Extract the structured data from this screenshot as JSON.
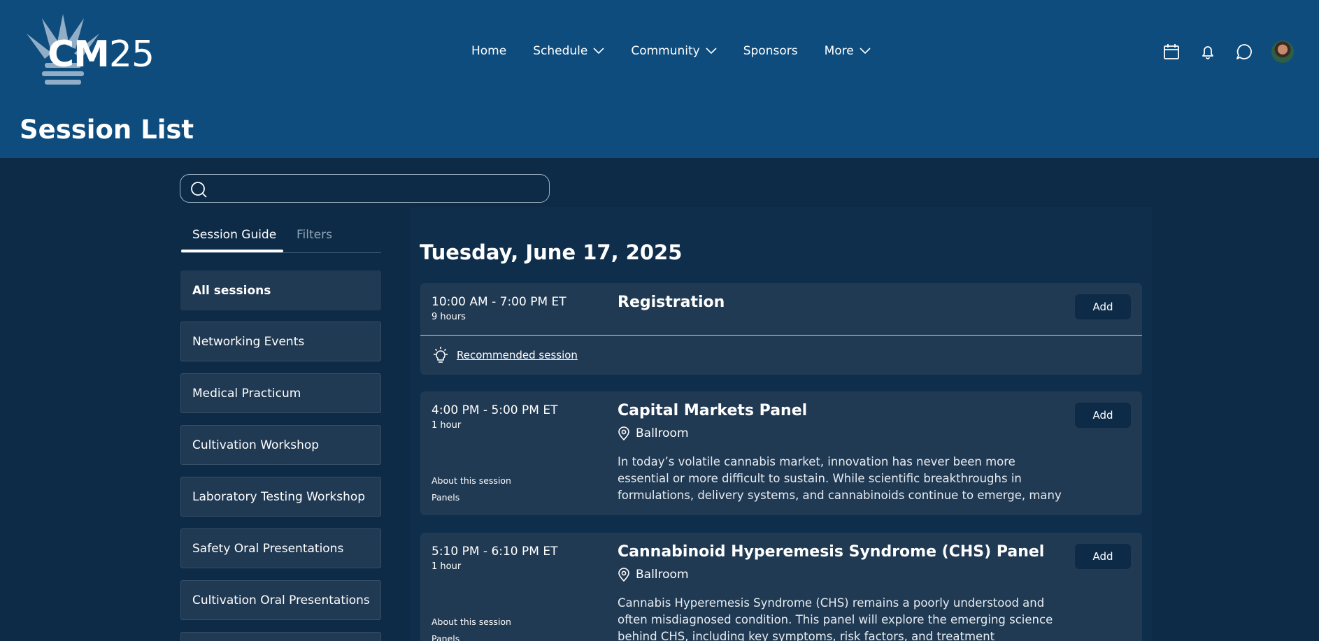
{
  "header": {
    "logo": {
      "bold": "CM",
      "light": "25"
    },
    "nav": [
      {
        "label": "Home",
        "dropdown": false
      },
      {
        "label": "Schedule",
        "dropdown": true
      },
      {
        "label": "Community",
        "dropdown": true
      },
      {
        "label": "Sponsors",
        "dropdown": false
      },
      {
        "label": "More",
        "dropdown": true
      }
    ],
    "icons": [
      "calendar-icon",
      "bell-icon",
      "chat-icon",
      "avatar"
    ]
  },
  "page": {
    "title": "Session List"
  },
  "search": {
    "placeholder": "",
    "value": ""
  },
  "tabs": {
    "active": "Session Guide",
    "inactive": "Filters"
  },
  "sidebar": {
    "items": [
      "All sessions",
      "Networking Events",
      "Medical Practicum",
      "Cultivation Workshop",
      "Laboratory Testing Workshop",
      "Safety Oral Presentations",
      "Cultivation Oral Presentations"
    ]
  },
  "main": {
    "date": "Tuesday, June 17, 2025",
    "add_label": "Add",
    "sessions": [
      {
        "time": "10:00 AM - 7:00 PM ET",
        "duration": "9 hours",
        "title": "Registration",
        "recommended": "Recommended session"
      },
      {
        "time": "4:00 PM - 5:00 PM ET",
        "duration": "1 hour",
        "title": "Capital Markets Panel",
        "location": "Ballroom",
        "description": "In today’s volatile cannabis market, innovation has never been more essential or more difficult to sustain. While scientific breakthroughs in formulations, delivery systems, and cannabinoids continue to emerge, many never reach…",
        "about": "About this session",
        "track": "Panels"
      },
      {
        "time": "5:10 PM - 6:10 PM ET",
        "duration": "1 hour",
        "title": "Cannabinoid Hyperemesis Syndrome (CHS) Panel",
        "location": "Ballroom",
        "description": "Cannabis Hyperemesis Syndrome (CHS) remains a poorly understood and often misdiagnosed condition. This panel will explore the emerging science behind CHS, including key symptoms, risk factors, and treatment strategies…",
        "about": "About this session",
        "track": "Panels"
      }
    ]
  },
  "colors": {
    "header_bg": "#0e4c7e",
    "page_bg": "#0d2b47",
    "card_bg": "#213a53"
  }
}
